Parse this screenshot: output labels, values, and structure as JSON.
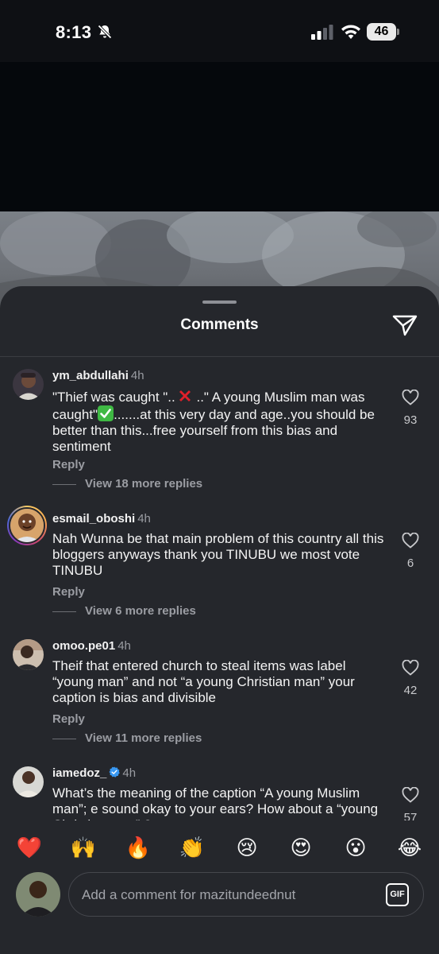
{
  "status_bar": {
    "time": "8:13",
    "battery": "46",
    "icons": [
      "bell-slash-icon",
      "signal-icon",
      "wifi-icon",
      "battery-icon"
    ]
  },
  "sheet": {
    "title": "Comments",
    "share_icon": "paper-plane-icon"
  },
  "comments": [
    {
      "username": "ym_abdullahi",
      "age": "4h",
      "verified": false,
      "text_parts": [
        "\"Thief was caught \"..",
        " ..\" A young Muslim man was caught\"",
        ".......at this very day and age..you should be better than this...free yourself from this bias and sentiment"
      ],
      "inline_emojis": [
        "cross-mark-emoji",
        "check-mark-emoji"
      ],
      "reply_label": "Reply",
      "view_replies": "View 18 more replies",
      "likes": "93"
    },
    {
      "username": "esmail_oboshi",
      "age": "4h",
      "verified": false,
      "has_story": true,
      "text": "Nah Wunna be that main problem of this country all this bloggers anyways thank you TINUBU we most vote TINUBU",
      "reply_label": "Reply",
      "view_replies": "View 6 more replies",
      "likes": "6"
    },
    {
      "username": "omoo.pe01",
      "age": "4h",
      "verified": false,
      "text": "Theif that entered church to steal items was label “young man” and not “a young Christian man” your caption is bias and divisible",
      "reply_label": "Reply",
      "view_replies": "View 11 more replies",
      "likes": "42"
    },
    {
      "username": "iamedoz_",
      "age": "4h",
      "verified": true,
      "text": "What’s the meaning of the caption “A young Muslim man”; e sound okay to your ears? How about a “young Christian man” ?",
      "likes": "57"
    }
  ],
  "reactions": [
    "❤️",
    "🙌",
    "🔥",
    "👏",
    "😢",
    "😍",
    "😮",
    "😂"
  ],
  "composer": {
    "placeholder": "Add a comment for mazitundeednut",
    "gif_label": "GIF"
  }
}
